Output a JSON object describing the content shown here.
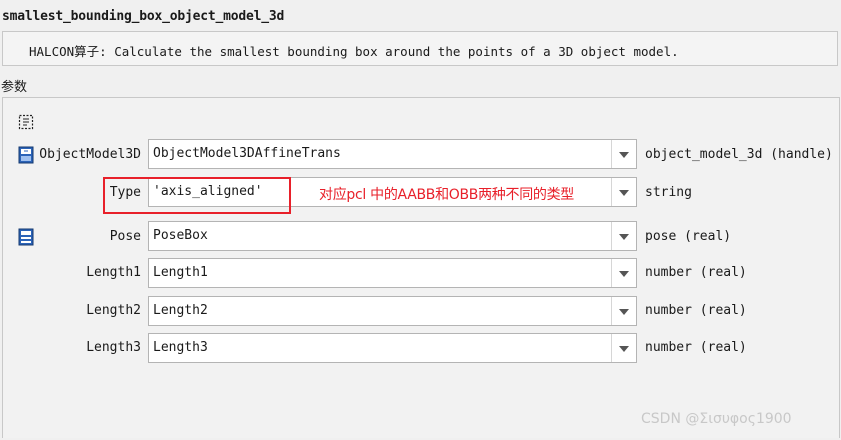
{
  "operator": {
    "title": "smallest_bounding_box_object_model_3d",
    "description": "HALCON算子: Calculate the smallest bounding box around the points of a 3D object model."
  },
  "params_label": "参数",
  "parameters": [
    {
      "label": "ObjectModel3D",
      "value": "ObjectModel3DAffineTrans",
      "semantic": "object_model_3d (handle)",
      "icon": "input-object-icon"
    },
    {
      "label": "Type",
      "value": "'axis_aligned'",
      "semantic": "string",
      "icon": ""
    },
    {
      "label": "Pose",
      "value": "PoseBox",
      "semantic": "pose (real)",
      "icon": "output-control-icon"
    },
    {
      "label": "Length1",
      "value": "Length1",
      "semantic": "number (real)",
      "icon": ""
    },
    {
      "label": "Length2",
      "value": "Length2",
      "semantic": "number (real)",
      "icon": ""
    },
    {
      "label": "Length3",
      "value": "Length3",
      "semantic": "number (real)",
      "icon": ""
    }
  ],
  "annotation": {
    "text": "对应pcl 中的AABB和OBB两种不同的类型",
    "color": "#e8202a"
  },
  "watermark": "CSDN @Σισυφος1900"
}
